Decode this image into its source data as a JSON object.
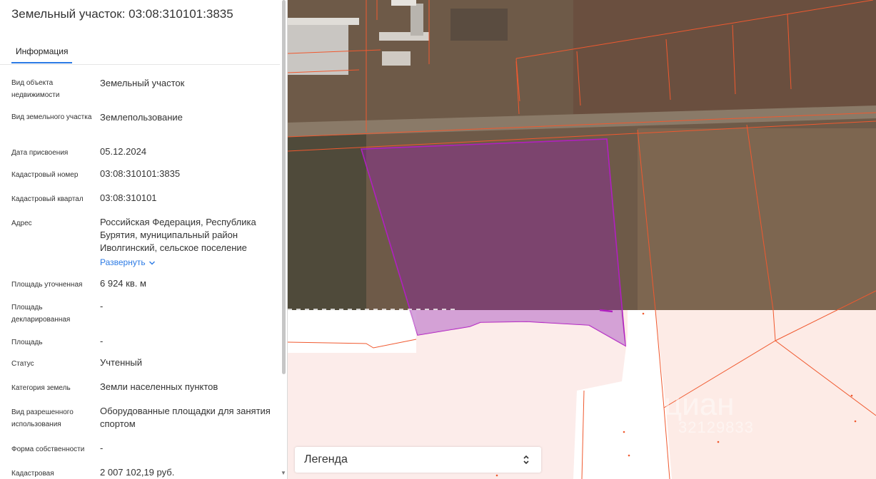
{
  "panel": {
    "title": "Земельный участок: 03:08:310101:3835",
    "tab": "Информация",
    "rows": [
      {
        "label": "Вид объекта недвижимости",
        "value": "Земельный участок"
      },
      {
        "label": "Вид земельного участка",
        "value": "Землепользование"
      },
      {
        "label": "Дата присвоения",
        "value": "05.12.2024"
      },
      {
        "label": "Кадастровый номер",
        "value": "03:08:310101:3835"
      },
      {
        "label": "Кадастровый квартал",
        "value": "03:08:310101"
      },
      {
        "label": "Адрес",
        "value": "Российская Федерация, Республика Бурятия, муниципальный район Иволгинский, сельское поселение"
      },
      {
        "label": "Площадь уточненная",
        "value": "6 924 кв. м"
      },
      {
        "label": "Площадь декларированная",
        "value": "-"
      },
      {
        "label": "Площадь",
        "value": "-"
      },
      {
        "label": "Статус",
        "value": "Учтенный"
      },
      {
        "label": "Категория земель",
        "value": "Земли населенных пунктов"
      },
      {
        "label": "Вид разрешенного использования",
        "value": "Оборудованные площадки для занятия спортом"
      },
      {
        "label": "Форма собственности",
        "value": "-"
      },
      {
        "label": "Кадастровая",
        "value": "2 007 102,19 руб."
      }
    ],
    "expand_label": "Развернуть"
  },
  "map": {
    "legend_label": "Легенда",
    "watermark": "циан",
    "watermark_phone": "32129833",
    "colors": {
      "parcel_fill": "#8e2a9e",
      "parcel_stroke": "#b020c0",
      "boundary": "#f0592f",
      "plan_bg": "#fdebe6"
    }
  }
}
